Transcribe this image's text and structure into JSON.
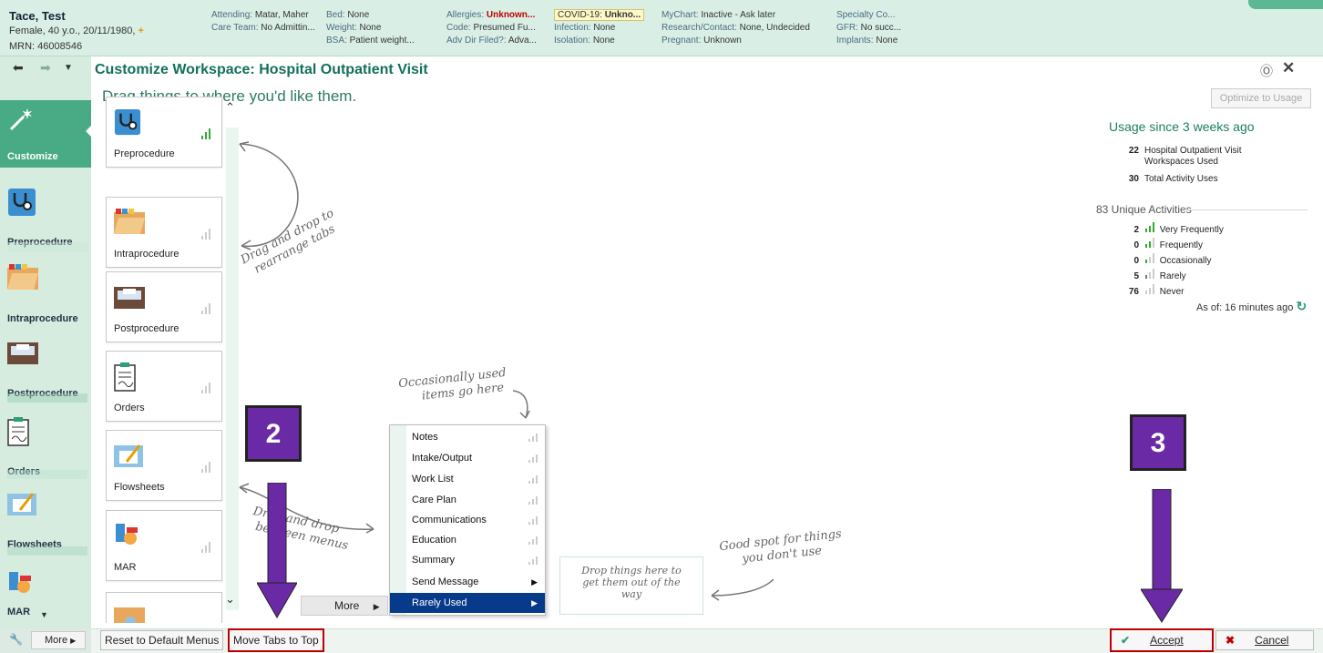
{
  "header": {
    "patient_name": "Tace, Test",
    "patient_sub": "Female, 40 y.o., 20/11/1980,",
    "mrn": "MRN: 46008546",
    "col1": [
      {
        "k": "Attending:",
        "v": "Matar, Maher"
      },
      {
        "k": "Care Team:",
        "v": "No Admittin..."
      }
    ],
    "col2": [
      {
        "k": "Bed:",
        "v": "None"
      },
      {
        "k": "Weight:",
        "v": "None"
      },
      {
        "k": "BSA:",
        "v": "Patient weight..."
      }
    ],
    "col3": [
      {
        "k": "Allergies:",
        "v": "Unknown..."
      },
      {
        "k": "Code:",
        "v": "Presumed Fu..."
      },
      {
        "k": "Adv Dir Filed?:",
        "v": "Adva..."
      }
    ],
    "col4": [
      {
        "k": "COVID-19:",
        "v": "Unkno..."
      },
      {
        "k": "Infection:",
        "v": "None"
      },
      {
        "k": "Isolation:",
        "v": "None"
      }
    ],
    "col5": [
      {
        "k": "MyChart:",
        "v": "Inactive - Ask later"
      },
      {
        "k": "Research/Contact:",
        "v": "None, Undecided"
      },
      {
        "k": "Pregnant:",
        "v": "Unknown"
      }
    ],
    "col6": [
      {
        "k": "Specialty Co...",
        "v": ""
      },
      {
        "k": "GFR:",
        "v": "No succ..."
      },
      {
        "k": "Implants:",
        "v": "None"
      }
    ]
  },
  "sidebar": {
    "items": [
      {
        "label": "Customize",
        "icon": "magic-wand-icon"
      },
      {
        "label": "Preprocedure",
        "icon": "stethoscope-icon"
      },
      {
        "label": "Intraprocedure",
        "icon": "folder-icon"
      },
      {
        "label": "Postprocedure",
        "icon": "bed-icon"
      },
      {
        "label": "Orders",
        "icon": "clipboard-icon"
      },
      {
        "label": "Flowsheets",
        "icon": "flowsheet-icon"
      },
      {
        "label": "MAR",
        "icon": "pill-icon"
      }
    ],
    "more_label": "More"
  },
  "main": {
    "title": "Customize Workspace: Hospital Outpatient Visit",
    "subtitle": "Drag things to where you'd like them.",
    "optimize_label": "Optimize to Usage",
    "tabs": [
      {
        "label": "Preprocedure",
        "icon": "stethoscope-icon",
        "level": "very-frequent"
      },
      {
        "label": "Intraprocedure",
        "icon": "folder-icon",
        "level": "never"
      },
      {
        "label": "Postprocedure",
        "icon": "bed-icon",
        "level": "never"
      },
      {
        "label": "Orders",
        "icon": "clipboard-icon",
        "level": "never"
      },
      {
        "label": "Flowsheets",
        "icon": "flowsheet-icon",
        "level": "never"
      },
      {
        "label": "MAR",
        "icon": "pill-icon",
        "level": "never"
      }
    ],
    "hint_rearrange": [
      "Drag and drop to",
      "rearrange tabs"
    ],
    "hint_between": [
      "Drag and drop",
      "between menus"
    ],
    "hint_occasional": [
      "Occasionally used",
      "items go here"
    ],
    "hint_good_spot": [
      "Good spot for things",
      "you don't use"
    ],
    "menu_items": [
      {
        "label": "Notes"
      },
      {
        "label": "Intake/Output"
      },
      {
        "label": "Work List"
      },
      {
        "label": "Care Plan"
      },
      {
        "label": "Communications"
      },
      {
        "label": "Education"
      },
      {
        "label": "Summary"
      },
      {
        "label": "Send Message"
      },
      {
        "label": "Rarely Used"
      }
    ],
    "more_button": "More",
    "drop_box": [
      "Drop things here to",
      "get them out of the",
      "way"
    ]
  },
  "usage": {
    "heading": "Usage since 3 weeks ago",
    "workspaces_count": "22",
    "workspaces_label": "Hospital Outpatient Visit",
    "workspaces_label2": "Workspaces Used",
    "activity_count": "30",
    "activity_label": "Total Activity Uses",
    "unique_heading": "83 Unique Activities",
    "rows": [
      {
        "count": "2",
        "label": "Very Frequently"
      },
      {
        "count": "0",
        "label": "Frequently"
      },
      {
        "count": "0",
        "label": "Occasionally"
      },
      {
        "count": "5",
        "label": "Rarely"
      },
      {
        "count": "76",
        "label": "Never"
      }
    ],
    "as_of": "As of: 16 minutes ago"
  },
  "footer": {
    "reset_label": "Reset to Default Menus",
    "move_tabs_label": "Move Tabs to Top",
    "accept_label": "Accept",
    "cancel_label": "Cancel"
  },
  "annotations": {
    "badge2": "2",
    "badge3": "3"
  },
  "colors": {
    "accent": "#48ab86",
    "highlight": "#c00000",
    "badge": "#6a2aa6"
  }
}
